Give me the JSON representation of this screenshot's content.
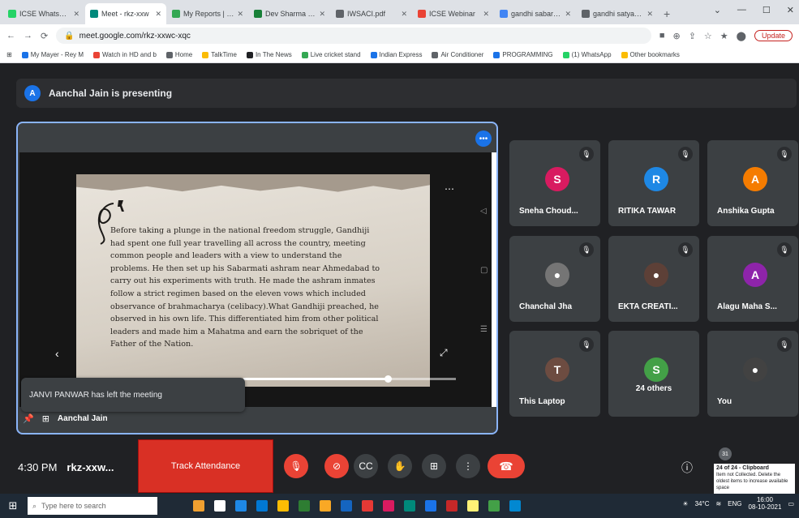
{
  "browser": {
    "tabs": [
      {
        "title": "ICSE WhatsApp",
        "color": "#25d366",
        "active": false
      },
      {
        "title": "Meet - rkz-xxw",
        "color": "#00897b",
        "active": true
      },
      {
        "title": "My Reports | Go",
        "color": "#34a853",
        "active": false
      },
      {
        "title": "Dev Sharma - Go",
        "color": "#188038",
        "active": false
      },
      {
        "title": "IWSACI.pdf",
        "color": "#5f6368",
        "active": false
      },
      {
        "title": "ICSE Webinar",
        "color": "#ea4335",
        "active": false
      },
      {
        "title": "gandhi sabarmati",
        "color": "#4285f4",
        "active": false
      },
      {
        "title": "gandhi satyagraha",
        "color": "#5f6368",
        "active": false
      }
    ],
    "url": "meet.google.com/rkz-xxwc-xqc",
    "update_label": "Update",
    "bookmarks": [
      {
        "label": "My Mayer - Rey M",
        "color": "#1a73e8"
      },
      {
        "label": "Watch in HD and b",
        "color": "#ea4335"
      },
      {
        "label": "Home",
        "color": "#5f6368"
      },
      {
        "label": "TalkTime",
        "color": "#fbbc04"
      },
      {
        "label": "In The News",
        "color": "#202124"
      },
      {
        "label": "Live cricket stand",
        "color": "#34a853"
      },
      {
        "label": "Indian Express",
        "color": "#1a73e8"
      },
      {
        "label": "Air Conditioner",
        "color": "#5f6368"
      },
      {
        "label": "PROGRAMMING",
        "color": "#1a73e8"
      },
      {
        "label": "(1) WhatsApp",
        "color": "#25d366"
      },
      {
        "label": "Other bookmarks",
        "color": "#fbbc04"
      }
    ]
  },
  "meet": {
    "presenter_initial": "A",
    "presenting_text": "Aanchal Jain is presenting",
    "slide_text": "Before taking a plunge in the national freedom struggle, Gandhiji had spent one full year travelling all across the country, meeting common people and leaders with a view to understand the problems. He then set up his Sabarmati ashram near Ahmedabad to carry out his experiments with truth. He made the ashram inmates follow a strict regimen based on the eleven vows which included observance of brahmacharya (celibacy).What Gandhiji preached, he observed in his own life. This differentiated him from other political leaders and made him a Mahatma and earn the sobriquet of the Father of the Nation.",
    "slide_progress": 0.68,
    "toast_text": "JANVI PANWAR has left the meeting",
    "main_tile_name": "Aanchal Jain",
    "participants": [
      {
        "name": "Sneha Choud...",
        "initial": "S",
        "color": "#d81b60"
      },
      {
        "name": "RITIKA TAWAR",
        "initial": "R",
        "color": "#1e88e5"
      },
      {
        "name": "Anshika Gupta",
        "initial": "A",
        "color": "#f57c00"
      },
      {
        "name": "Chanchal Jha",
        "initial": "",
        "color": "#757575"
      },
      {
        "name": "EKTA CREATI...",
        "initial": "",
        "color": "#5d4037"
      },
      {
        "name": "Alagu Maha S...",
        "initial": "A",
        "color": "#8e24aa"
      },
      {
        "name": "This Laptop",
        "initial": "T",
        "color": "#6d4c41"
      },
      {
        "name": "24 others",
        "initial": "S",
        "color": "#43a047"
      },
      {
        "name": "You",
        "initial": "",
        "color": "#424242"
      }
    ],
    "time": "4:30 PM",
    "meeting_code": "rkz-xxw...",
    "attendance_label": "Track Attendance",
    "people_count": "31",
    "clipboard_title": "24 of 24 - Clipboard",
    "clipboard_text": "Item not Collected. Delete the oldest items to increase available space"
  },
  "taskbar": {
    "search_placeholder": "Type here to search",
    "tray_temp": "34°C",
    "tray_lang": "ENG",
    "tray_time": "16:00",
    "tray_date": "08-10-2021"
  }
}
